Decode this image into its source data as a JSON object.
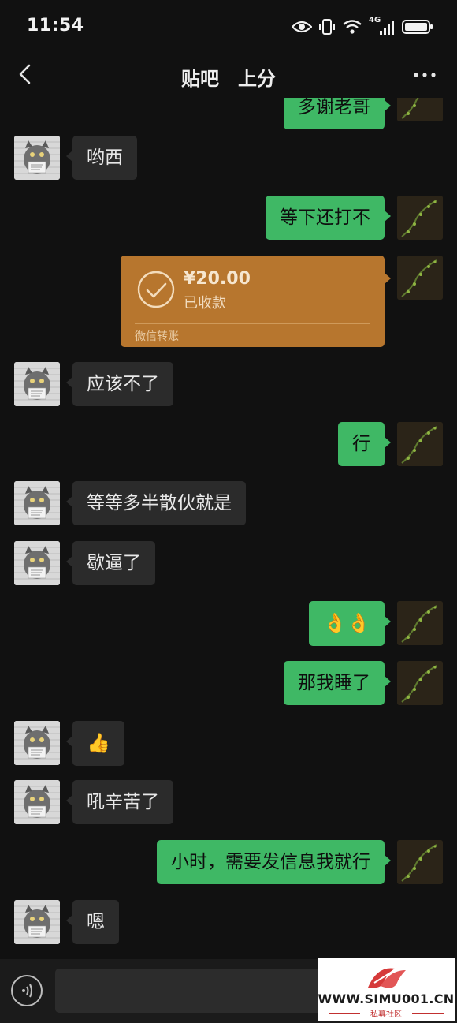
{
  "status_bar": {
    "time": "11:54",
    "network": "4G"
  },
  "header": {
    "title_left": "贴吧",
    "title_right": "上分"
  },
  "transfer": {
    "amount": "¥20.00",
    "status": "已收款",
    "source": "微信转账"
  },
  "messages": [
    {
      "side": "out",
      "text": "多谢老哥"
    },
    {
      "side": "in",
      "text": "哟西"
    },
    {
      "side": "out",
      "text": "等下还打不"
    },
    {
      "side": "out",
      "type": "transfer"
    },
    {
      "side": "in",
      "text": "应该不了"
    },
    {
      "side": "out",
      "text": "行"
    },
    {
      "side": "in",
      "text": "等等多半散伙就是"
    },
    {
      "side": "in",
      "text": "歇逼了"
    },
    {
      "side": "out",
      "text": "👌👌"
    },
    {
      "side": "out",
      "text": "那我睡了"
    },
    {
      "side": "in",
      "text": "👍"
    },
    {
      "side": "in",
      "text": "吼辛苦了"
    },
    {
      "side": "out",
      "text": "小时，需要发信息我就行"
    },
    {
      "side": "in",
      "text": "嗯"
    }
  ],
  "watermark": {
    "url": "WWW.SIMU001.CN",
    "subtitle": "私募社区"
  },
  "colors": {
    "background": "#111111",
    "bubble_out": "#3fb865",
    "bubble_in": "#2b2b2b",
    "transfer": "#b7762e"
  },
  "icons": {
    "back": "chevron-left-icon",
    "more": "more-dots-icon",
    "voice": "voice-icon"
  }
}
